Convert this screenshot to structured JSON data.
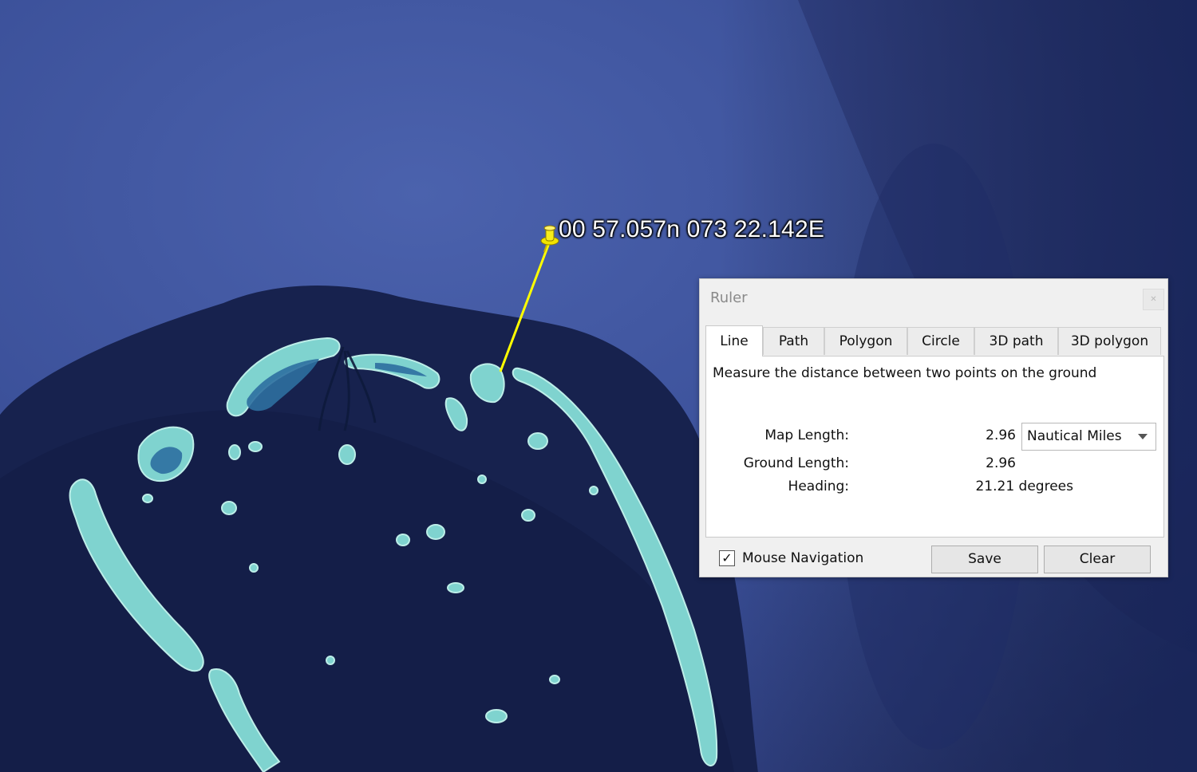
{
  "map": {
    "placemark_label": "00 57.057n 073 22.142E",
    "pin_icon": "yellow-pushpin-icon",
    "measure_line_color": "#ffff00"
  },
  "ruler": {
    "title": "Ruler",
    "tabs": [
      "Line",
      "Path",
      "Polygon",
      "Circle",
      "3D path",
      "3D polygon"
    ],
    "active_tab": "Line",
    "description": "Measure the distance between two points on the ground",
    "map_length_label": "Map Length:",
    "map_length_value": "2.96",
    "unit_selected": "Nautical Miles",
    "ground_length_label": "Ground Length:",
    "ground_length_value": "2.96",
    "heading_label": "Heading:",
    "heading_value": "21.21 degrees",
    "mouse_navigation_label": "Mouse Navigation",
    "mouse_navigation_checked": true,
    "save_label": "Save",
    "clear_label": "Clear"
  }
}
